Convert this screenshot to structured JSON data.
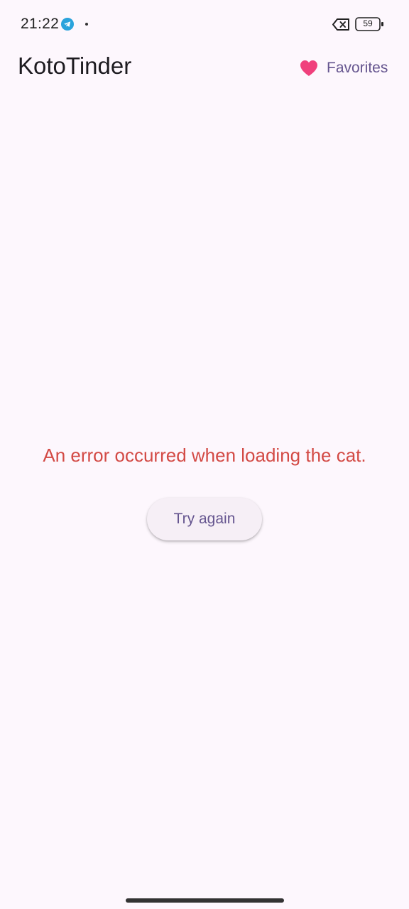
{
  "status_bar": {
    "time": "21:22",
    "battery_level": "59",
    "icons": [
      "telegram-icon",
      "dot",
      "no-signal-icon",
      "battery-icon"
    ]
  },
  "app_bar": {
    "title": "KotoTinder",
    "favorites_label": "Favorites",
    "favorites_icon": "heart-icon"
  },
  "content": {
    "error_message": "An error occurred when loading the cat.",
    "retry_label": "Try again"
  },
  "colors": {
    "background": "#FDF7FD",
    "heart": "#F0407C",
    "accent": "#65558F",
    "error": "#D34A45"
  }
}
